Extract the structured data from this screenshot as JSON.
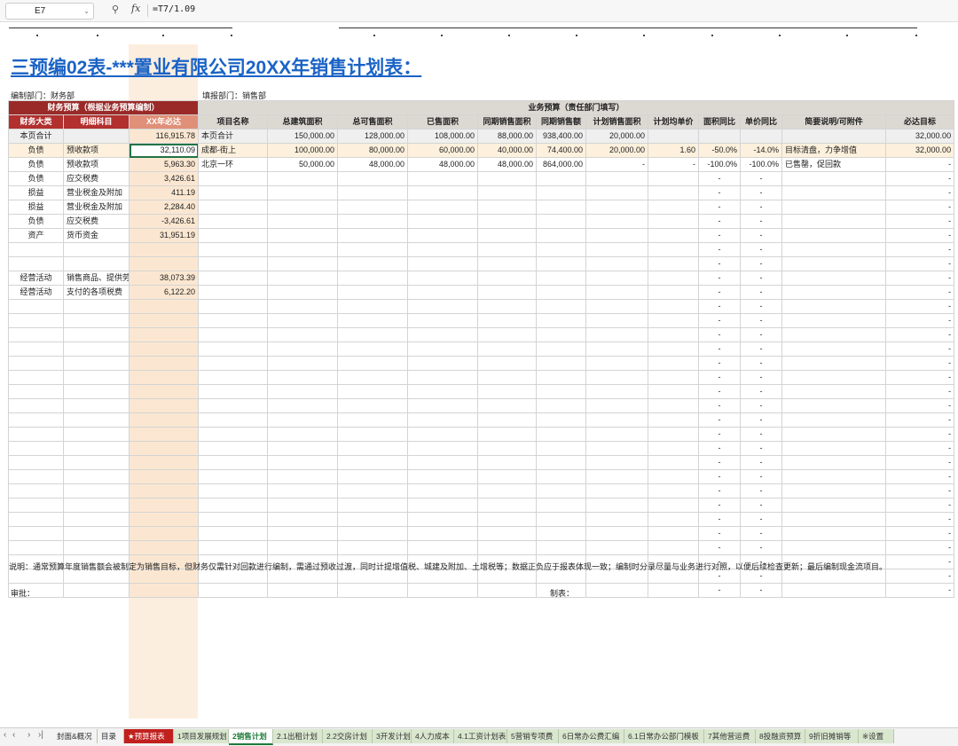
{
  "formula_bar": {
    "cell_ref": "E7",
    "formula": "=T7/1.09"
  },
  "title": "三预编02表-***置业有限公司20XX年销售计划表：",
  "dept_left": "编制部门：财务部",
  "dept_right": "填报部门：销售部",
  "left_table": {
    "group_header": "财务预算（根据业务预算编制）",
    "headers": [
      "财务大类",
      "明细科目",
      "XX年必达"
    ],
    "total": [
      "本页合计",
      "",
      "116,915.78"
    ],
    "rows": [
      [
        "负债",
        "预收款项",
        "32,110.09"
      ],
      [
        "负债",
        "预收款项",
        "5,963.30"
      ],
      [
        "负债",
        "应交税费",
        "3,426.61"
      ],
      [
        "损益",
        "营业税金及附加",
        "411.19"
      ],
      [
        "损益",
        "营业税金及附加",
        "2,284.40"
      ],
      [
        "负债",
        "应交税费",
        "-3,426.61"
      ],
      [
        "资产",
        "货币资金",
        "31,951.19"
      ],
      [
        "",
        "",
        ""
      ],
      [
        "",
        "",
        ""
      ],
      [
        "经营活动",
        "销售商品、提供劳",
        "38,073.39"
      ],
      [
        "经营活动",
        "支付的各项税费",
        "6,122.20"
      ]
    ]
  },
  "right_table": {
    "group_header": "业务预算（责任部门填写）",
    "headers": [
      "项目名称",
      "总建筑面积",
      "总可售面积",
      "已售面积",
      "同期销售面积",
      "同期销售额",
      "计划销售面积",
      "计划均单价",
      "面积同比",
      "单价同比",
      "简要说明/可附件",
      "必达目标"
    ],
    "total": [
      "本页合计",
      "150,000.00",
      "128,000.00",
      "108,000.00",
      "88,000.00",
      "938,400.00",
      "20,000.00",
      "",
      "",
      "",
      "",
      "32,000.00"
    ],
    "rows": [
      [
        "成都-街上",
        "100,000.00",
        "80,000.00",
        "60,000.00",
        "40,000.00",
        "74,400.00",
        "20,000.00",
        "1.60",
        "-50.0%",
        "-14.0%",
        "目标清盘，力争增值",
        "32,000.00"
      ],
      [
        "北京一环",
        "50,000.00",
        "48,000.00",
        "48,000.00",
        "48,000.00",
        "864,000.00",
        "-",
        "-",
        "-100.0%",
        "-100.0%",
        "已售罄，促回款",
        "-"
      ]
    ],
    "dash": "-"
  },
  "note": "说明：通常预算年度销售额会被制定为销售目标，但财务仅需针对回款进行编制，需通过预收过渡，同时计提增值税、城建及附加、土增税等；数据正负应于报表体现一致；编制时分录尽量与业务进行对照，以便后续检查更新；最后编制现金流项目。",
  "approve_label": "审批：",
  "maker_label": "制表：",
  "sheet_tabs": [
    "封面&概况",
    "目录",
    "★预算报表",
    "1项目发展规划",
    "2销售计划",
    "2.1出租计划",
    "2.2交房计划",
    "3开发计划",
    "4人力成本",
    "4.1工资计划表",
    "5营销专项费",
    "6日常办公费汇编",
    "6.1日常办公部门模板",
    "7其他营运费",
    "8投融资预算",
    "9折旧摊销等",
    "※设置"
  ],
  "active_tab": "2销售计划",
  "colors": {
    "accent_red": "#b2302e",
    "title_blue": "#1a63c6",
    "highlight": "#fae0c4",
    "active_green": "#1e7a3a"
  }
}
